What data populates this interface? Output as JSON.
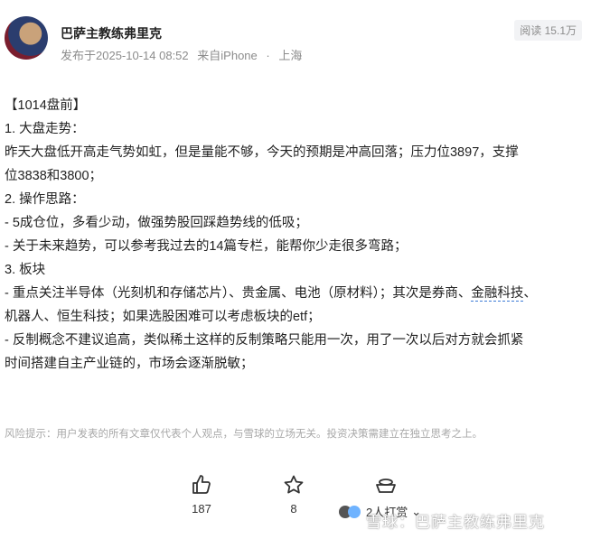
{
  "post": {
    "author": "巴萨主教练弗里克",
    "published": "发布于2025-10-14 08:52",
    "device": "来自iPhone",
    "separator": "·",
    "location": "上海",
    "views": "阅读 15.1万"
  },
  "article": {
    "title": "【1014盘前】",
    "s1_heading": "1. 大盘走势：",
    "s1_text_line1": "昨天大盘低开高走气势如虹，但是量能不够，今天的预期是冲高回落；压力位3897，支撑",
    "s1_text_line2": "位3838和3800；",
    "s2_heading": "2. 操作思路：",
    "s2_item1": "- 5成仓位，多看少动，做强势股回踩趋势线的低吸；",
    "s2_item2": "- 关于未来趋势，可以参考我过去的14篇专栏，能帮你少走很多弯路；",
    "s3_heading": "3. 板块",
    "s3_item1_part1": "- 重点关注半导体（光刻机和存储芯片）、贵金属、电池（原材料）；其次是券商、",
    "s3_item1_link": "金融科技",
    "s3_item1_part2": "、",
    "s3_item1_line2": "机器人、恒生科技；如果选股困难可以考虑板块的etf；",
    "s3_item2_line1": "- 反制概念不建议追高，类似稀土这样的反制策略只能用一次，用了一次以后对方就会抓紧",
    "s3_item2_line2": "时间搭建自主产业链的，市场会逐渐脱敏；"
  },
  "disclaimer": "风险提示：用户发表的所有文章仅代表个人观点，与雪球的立场无关。投资决策需建立在独立思考之上。",
  "actions": {
    "like_count": "187",
    "favorite_count": "8",
    "tip_text": "2人打赏",
    "tip_chevron": "⌄"
  },
  "watermark": "雪球：巴萨主教练弗里克",
  "icons": {
    "avatar": "user-avatar",
    "like": "thumbs-up-icon",
    "favorite": "star-icon",
    "tip": "tip-gift-icon"
  },
  "colors": {
    "link_underline": "#3b7ad6",
    "muted": "#8c8c8c"
  }
}
